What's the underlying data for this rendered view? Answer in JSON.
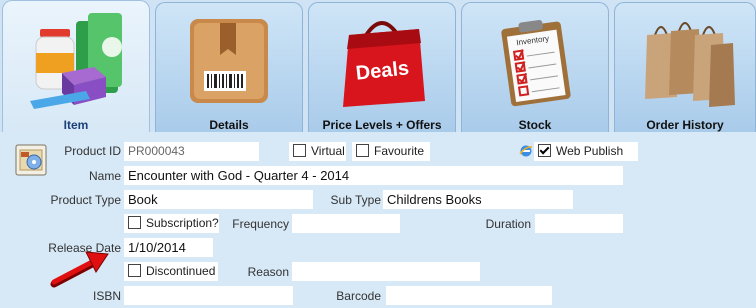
{
  "tabs": [
    {
      "label": "Item"
    },
    {
      "label": "Details"
    },
    {
      "label": "Price Levels + Offers",
      "art_text": "Deals"
    },
    {
      "label": "Stock",
      "art_text": "Inventory"
    },
    {
      "label": "Order History"
    }
  ],
  "form": {
    "product_id": {
      "label": "Product ID",
      "value": "PR000043"
    },
    "virtual": {
      "label": "Virtual",
      "checked": false
    },
    "favourite": {
      "label": "Favourite",
      "checked": false
    },
    "web_publish": {
      "label": "Web Publish",
      "checked": true
    },
    "name": {
      "label": "Name",
      "value": "Encounter with God - Quarter 4 - 2014"
    },
    "product_type": {
      "label": "Product Type",
      "value": "Book"
    },
    "sub_type": {
      "label": "Sub Type",
      "value": "Childrens Books"
    },
    "subscription": {
      "label": "Subscription?",
      "checked": false
    },
    "frequency": {
      "label": "Frequency",
      "value": ""
    },
    "duration": {
      "label": "Duration",
      "value": ""
    },
    "release_date": {
      "label": "Release Date",
      "value": "1/10/2014"
    },
    "discontinued": {
      "label": "Discontinued",
      "checked": false
    },
    "reason": {
      "label": "Reason",
      "value": ""
    },
    "isbn": {
      "label": "ISBN",
      "value": ""
    },
    "barcode": {
      "label": "Barcode",
      "value": ""
    }
  },
  "colors": {
    "arrow": "#e01010",
    "active_tab_label": "#1d3f7a",
    "panel": "#d7e8f6"
  },
  "icons": [
    "product-bottles-icon",
    "cardboard-box-icon",
    "deals-bag-icon",
    "inventory-clipboard-icon",
    "shopping-bags-icon",
    "product-card-icon",
    "internet-explorer-icon",
    "red-arrow-icon"
  ]
}
